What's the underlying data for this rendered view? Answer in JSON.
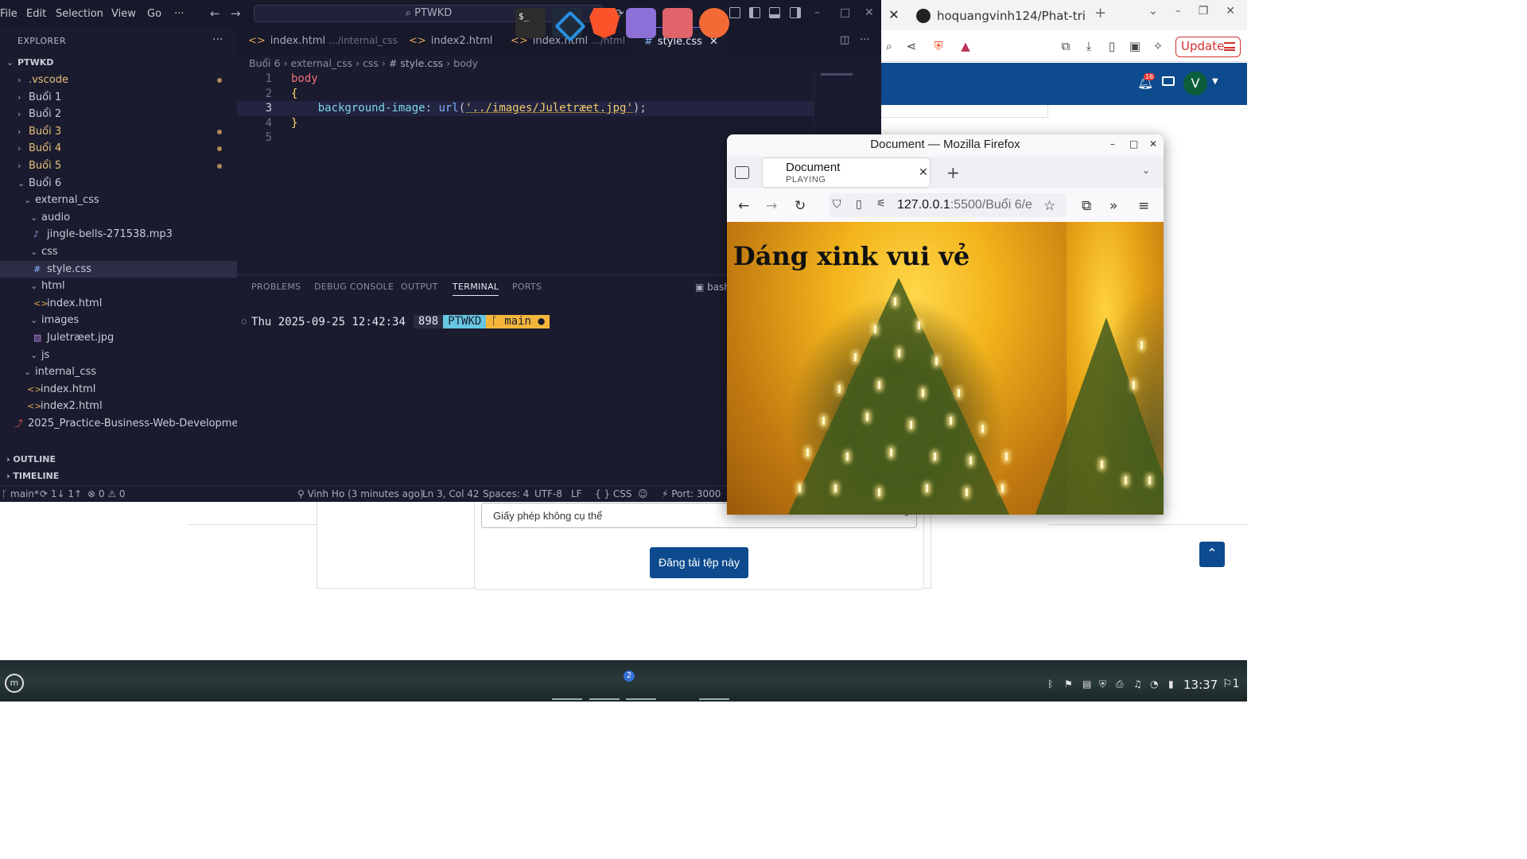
{
  "vscode": {
    "menu": [
      "File",
      "Edit",
      "Selection",
      "View",
      "Go",
      "···"
    ],
    "search": "PTWKD",
    "explorer": {
      "title": "EXPLORER",
      "root": "PTWKD",
      "items": [
        {
          "label": ".vscode",
          "indent": 1,
          "kind": "folder",
          "open": false,
          "modified": true
        },
        {
          "label": "Buổi 1",
          "indent": 1,
          "kind": "folder",
          "open": false,
          "modified": false
        },
        {
          "label": "Buổi 2",
          "indent": 1,
          "kind": "folder",
          "open": false,
          "modified": false
        },
        {
          "label": "Buổi 3",
          "indent": 1,
          "kind": "folder",
          "open": false,
          "modified": true
        },
        {
          "label": "Buổi 4",
          "indent": 1,
          "kind": "folder",
          "open": false,
          "modified": true
        },
        {
          "label": "Buổi 5",
          "indent": 1,
          "kind": "folder",
          "open": false,
          "modified": true
        },
        {
          "label": "Buổi 6",
          "indent": 1,
          "kind": "folder",
          "open": true,
          "modified": false
        },
        {
          "label": "external_css",
          "indent": 2,
          "kind": "folder",
          "open": true,
          "modified": false
        },
        {
          "label": "audio",
          "indent": 3,
          "kind": "folder",
          "open": true,
          "modified": false
        },
        {
          "label": "jingle-bells-271538.mp3",
          "indent": 4,
          "kind": "audio",
          "modified": false
        },
        {
          "label": "css",
          "indent": 3,
          "kind": "folder",
          "open": true,
          "modified": false
        },
        {
          "label": "style.css",
          "indent": 4,
          "kind": "css",
          "modified": false,
          "selected": true
        },
        {
          "label": "html",
          "indent": 3,
          "kind": "folder",
          "open": true,
          "modified": false
        },
        {
          "label": "index.html",
          "indent": 4,
          "kind": "html",
          "modified": false
        },
        {
          "label": "images",
          "indent": 3,
          "kind": "folder",
          "open": true,
          "modified": false
        },
        {
          "label": "Juletræet.jpg",
          "indent": 4,
          "kind": "image",
          "modified": false
        },
        {
          "label": "js",
          "indent": 3,
          "kind": "folder",
          "open": true,
          "modified": false
        },
        {
          "label": "internal_css",
          "indent": 2,
          "kind": "folder",
          "open": true,
          "modified": false
        },
        {
          "label": "index.html",
          "indent": 3,
          "kind": "html",
          "modified": false
        },
        {
          "label": "index2.html",
          "indent": 3,
          "kind": "html",
          "modified": false
        },
        {
          "label": "2025_Practice-Business-Web-Development...",
          "indent": 1,
          "kind": "pdf",
          "modified": false
        }
      ],
      "outline": "OUTLINE",
      "timeline": "TIMELINE"
    },
    "tabs": [
      {
        "label": "index.html",
        "desc": ".../internal_css",
        "icon": "<>",
        "active": false
      },
      {
        "label": "index2.html",
        "desc": "",
        "icon": "<>",
        "active": false
      },
      {
        "label": "index.html",
        "desc": ".../html",
        "icon": "<>",
        "active": false
      },
      {
        "label": "style.css",
        "desc": "",
        "icon": "#",
        "active": true
      }
    ],
    "breadcrumb": [
      "Buổi 6",
      "external_css",
      "css",
      "# style.css",
      "body"
    ],
    "code": [
      {
        "n": "1",
        "parts": [
          {
            "c": "sel",
            "t": "body"
          }
        ]
      },
      {
        "n": "2",
        "parts": [
          {
            "c": "brace",
            "t": "{"
          }
        ]
      },
      {
        "n": "3",
        "parts": [
          {
            "c": "punc",
            "t": "    "
          },
          {
            "c": "prop",
            "t": "background-image"
          },
          {
            "c": "punc",
            "t": ": "
          },
          {
            "c": "fn",
            "t": "url"
          },
          {
            "c": "punc",
            "t": "("
          },
          {
            "c": "str",
            "t": "'../images/Juletræet.jpg'"
          },
          {
            "c": "punc",
            "t": ");"
          }
        ]
      },
      {
        "n": "4",
        "parts": [
          {
            "c": "brace",
            "t": "}"
          }
        ]
      },
      {
        "n": "5",
        "parts": []
      }
    ],
    "panel_tabs": [
      "PROBLEMS",
      "DEBUG CONSOLE",
      "OUTPUT",
      "TERMINAL",
      "PORTS"
    ],
    "terminal": {
      "datetime": "Thu 2025-09-25 12:42:34",
      "count": "898",
      "dir": "PTWKD",
      "branch": "main",
      "shell": "bash"
    },
    "status": {
      "branch": "main*",
      "sync": "1↓ 1↑",
      "problems": "⊗ 0 ⚠ 0",
      "blame": "Vinh Ho (3 minutes ago)",
      "position": "Ln 3, Col 42",
      "spaces": "Spaces: 4",
      "encoding": "UTF-8",
      "eol": "LF",
      "language": "CSS",
      "port": "Port: 3000"
    }
  },
  "firefox": {
    "title": "Document — Mozilla Firefox",
    "tab_title": "Document",
    "tab_status": "PLAYING",
    "url_host": "127.0.0.1",
    "url_rest": ":5500/Buổi 6/e",
    "heading": "Dáng xink vui vẻ"
  },
  "background_browser": {
    "tab_title": "hoquangvinh124/Phat-tri",
    "update_label": "Update",
    "bell_count": "16",
    "avatar": "V",
    "license_select": "Giấy phép không cụ thể",
    "upload_button": "Đăng tải tệp này"
  },
  "taskbar": {
    "files_badge": "2",
    "clock": "13:37",
    "notifications": "1"
  },
  "colors": {
    "vscode_bg": "#1a1b2e",
    "accent_blue": "#0d4b8e",
    "terminal_dir": "#67c7e2",
    "terminal_branch": "#f4b63a"
  }
}
